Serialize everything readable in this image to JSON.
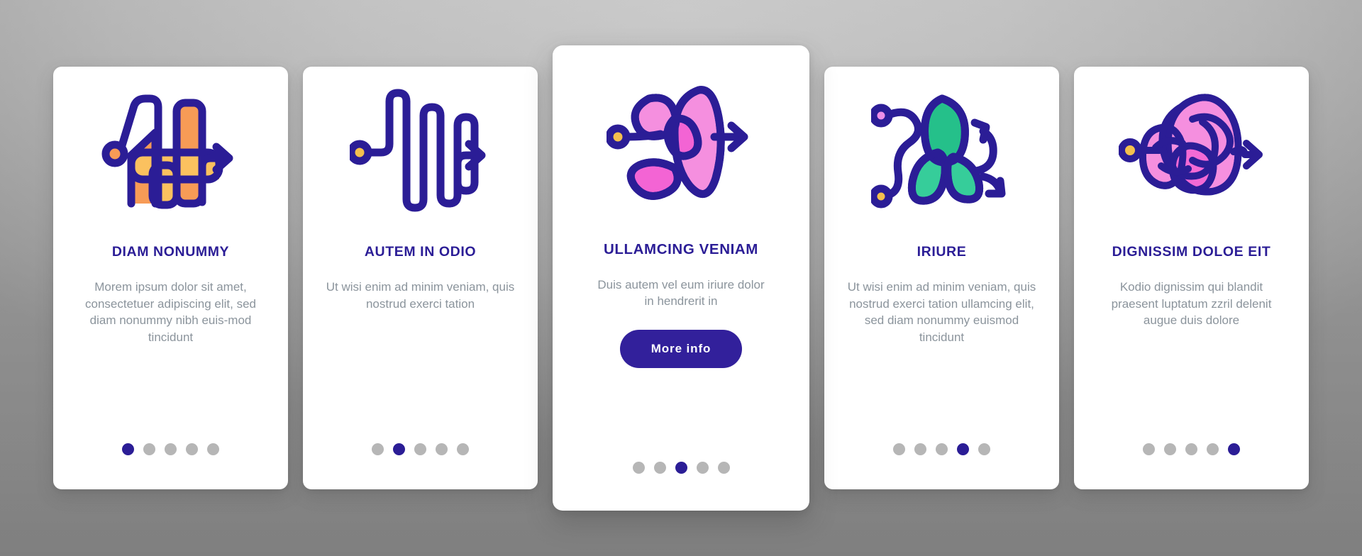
{
  "theme": {
    "accent": "#2b1d96",
    "button_bg": "#32209b",
    "body_text": "#8b949c",
    "dot_inactive": "#b6b6b6",
    "dot_active": "#2b1d96",
    "card_bg": "#ffffff",
    "page_bg_light": "#e4e4e4",
    "page_bg_dark": "#b3b3b3",
    "icon_stroke": "#2b1d96",
    "icon_orange": "#f79b56",
    "icon_orange_light": "#fbc15f",
    "icon_pink": "#f58fdf",
    "icon_pink_bright": "#f364d4",
    "icon_green": "#25c08a",
    "icon_green_light": "#36cd9a",
    "icon_violet": "#ef8fe8",
    "icon_dot_gold": "#f5c04e"
  },
  "cards": [
    {
      "icon_name": "bar-chart-tangle-arrow-icon",
      "title": "Diam nonummy",
      "body": "Morem ipsum dolor sit amet, consectetuer adipiscing elit, sed diam nonummy nibh euis-mod tincidunt",
      "dots": {
        "count": 5,
        "active": 0
      },
      "cta": null
    },
    {
      "icon_name": "zigzag-wave-arrow-icon",
      "title": "Autem in odio",
      "body": "Ut wisi enim ad minim veniam, quis nostrud exerci tation",
      "dots": {
        "count": 5,
        "active": 1
      },
      "cta": null
    },
    {
      "icon_name": "pink-knot-arrow-icon",
      "title": "Ullamcing veniam",
      "body": "Duis autem vel eum iriure dolor in hendrerit in",
      "dots": {
        "count": 5,
        "active": 2
      },
      "cta": "More info"
    },
    {
      "icon_name": "green-loop-arrow-icon",
      "title": "Iriure",
      "body": "Ut wisi enim ad minim veniam, quis nostrud exerci tation ullamcing elit, sed diam nonummy euismod tincidunt",
      "dots": {
        "count": 5,
        "active": 3
      },
      "cta": null
    },
    {
      "icon_name": "tangled-scribble-arrow-icon",
      "title": "Dignissim doloe eit",
      "body": "Kodio dignissim qui blandit praesent luptatum zzril delenit augue duis dolore",
      "dots": {
        "count": 5,
        "active": 4
      },
      "cta": null
    }
  ]
}
